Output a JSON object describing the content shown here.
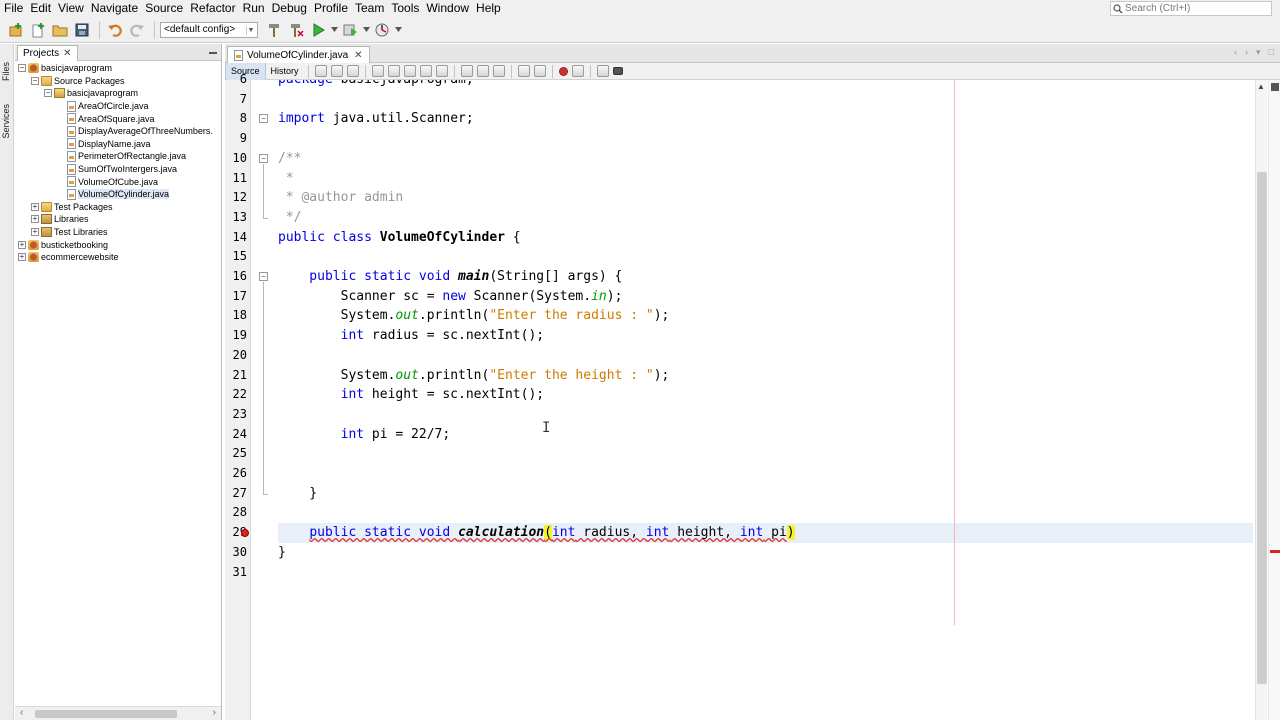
{
  "menu": [
    "File",
    "Edit",
    "View",
    "Navigate",
    "Source",
    "Refactor",
    "Run",
    "Debug",
    "Profile",
    "Team",
    "Tools",
    "Window",
    "Help"
  ],
  "search": {
    "placeholder": "Search (Ctrl+I)"
  },
  "toolbar": {
    "config": "<default config>"
  },
  "side_rail": [
    "Files",
    "Services"
  ],
  "projects_panel": {
    "tab_label": "Projects",
    "tree": [
      {
        "label": "basicjavaprogram",
        "type": "project",
        "depth": 0,
        "expanded": true
      },
      {
        "label": "Source Packages",
        "type": "folder",
        "depth": 1,
        "expanded": true
      },
      {
        "label": "basicjavaprogram",
        "type": "package",
        "depth": 2,
        "expanded": true
      },
      {
        "label": "AreaOfCircle.java",
        "type": "java",
        "depth": 3
      },
      {
        "label": "AreaOfSquare.java",
        "type": "java",
        "depth": 3
      },
      {
        "label": "DisplayAverageOfThreeNumbers.",
        "type": "java",
        "depth": 3
      },
      {
        "label": "DisplayName.java",
        "type": "java",
        "depth": 3
      },
      {
        "label": "PerimeterOfRectangle.java",
        "type": "java",
        "depth": 3
      },
      {
        "label": "SumOfTwoIntergers.java",
        "type": "java",
        "depth": 3
      },
      {
        "label": "VolumeOfCube.java",
        "type": "java",
        "depth": 3
      },
      {
        "label": "VolumeOfCylinder.java",
        "type": "java",
        "depth": 3,
        "selected": true
      },
      {
        "label": "Test Packages",
        "type": "folder",
        "depth": 1,
        "expanded": false
      },
      {
        "label": "Libraries",
        "type": "lib",
        "depth": 1,
        "expanded": false
      },
      {
        "label": "Test Libraries",
        "type": "lib",
        "depth": 1,
        "expanded": false
      },
      {
        "label": "busticketbooking",
        "type": "project",
        "depth": 0,
        "expanded": false
      },
      {
        "label": "ecommercewebsite",
        "type": "project",
        "depth": 0,
        "expanded": false
      }
    ]
  },
  "editor": {
    "file_tab": "VolumeOfCylinder.java",
    "modes": [
      "Source",
      "History"
    ],
    "active_mode": "Source",
    "line_numbers": [
      6,
      7,
      8,
      9,
      10,
      11,
      12,
      13,
      14,
      15,
      16,
      17,
      18,
      19,
      20,
      21,
      22,
      23,
      24,
      25,
      26,
      27,
      28,
      29,
      30,
      31
    ],
    "error_line": 29,
    "current_line": 29,
    "code": [
      [
        {
          "t": "package basicjavaprogram;",
          "c": "kw-partial"
        }
      ],
      [],
      [
        {
          "t": "import",
          "c": "kw"
        },
        {
          "t": " java.util.Scanner;",
          "c": ""
        }
      ],
      [],
      [
        {
          "t": "/**",
          "c": "cm"
        }
      ],
      [
        {
          "t": " *",
          "c": "cm"
        }
      ],
      [
        {
          "t": " * @author admin",
          "c": "cm"
        }
      ],
      [
        {
          "t": " */",
          "c": "cm"
        }
      ],
      [
        {
          "t": "public class ",
          "c": "kw"
        },
        {
          "t": "VolumeOfCylinder",
          "c": "cls"
        },
        {
          "t": " {",
          "c": ""
        }
      ],
      [],
      [
        {
          "t": "    public static void ",
          "c": "kw"
        },
        {
          "t": "main",
          "c": "fn-decl"
        },
        {
          "t": "(String[] args) {",
          "c": ""
        }
      ],
      [
        {
          "t": "        Scanner sc = ",
          "c": ""
        },
        {
          "t": "new",
          "c": "kw"
        },
        {
          "t": " Scanner(System.",
          "c": ""
        },
        {
          "t": "in",
          "c": "field"
        },
        {
          "t": ");",
          "c": ""
        }
      ],
      [
        {
          "t": "        System.",
          "c": ""
        },
        {
          "t": "out",
          "c": "field"
        },
        {
          "t": ".println(",
          "c": ""
        },
        {
          "t": "\"Enter the radius : \"",
          "c": "str"
        },
        {
          "t": ");",
          "c": ""
        }
      ],
      [
        {
          "t": "        int",
          "c": "kw"
        },
        {
          "t": " radius = sc.nextInt();",
          "c": ""
        }
      ],
      [],
      [
        {
          "t": "        System.",
          "c": ""
        },
        {
          "t": "out",
          "c": "field"
        },
        {
          "t": ".println(",
          "c": ""
        },
        {
          "t": "\"Enter the height : \"",
          "c": "str"
        },
        {
          "t": ");",
          "c": ""
        }
      ],
      [
        {
          "t": "        int",
          "c": "kw"
        },
        {
          "t": " height = sc.nextInt();",
          "c": ""
        }
      ],
      [],
      [
        {
          "t": "        int",
          "c": "kw"
        },
        {
          "t": " pi = 22/7;",
          "c": ""
        }
      ],
      [],
      [],
      [
        {
          "t": "    }",
          "c": ""
        }
      ],
      [],
      [
        {
          "t": "    ",
          "c": ""
        },
        {
          "t": "public static void ",
          "c": "kw err"
        },
        {
          "t": "calculation",
          "c": "fn-decl err"
        },
        {
          "t": "(",
          "c": "hl err"
        },
        {
          "t": "int",
          "c": "kw err"
        },
        {
          "t": " radius, ",
          "c": "err"
        },
        {
          "t": "int",
          "c": "kw err"
        },
        {
          "t": " height, ",
          "c": "err"
        },
        {
          "t": "int",
          "c": "kw err"
        },
        {
          "t": " pi",
          "c": "err"
        },
        {
          "t": ")",
          "c": "hl"
        }
      ],
      [
        {
          "t": "}",
          "c": ""
        }
      ],
      []
    ]
  },
  "colors": {
    "keyword": "#0000e6",
    "comment": "#969696",
    "string": "#ce7b00",
    "field": "#009900",
    "current_line": "#e9eff8",
    "bracket_match": "#f4f233",
    "error": "#dd2222"
  },
  "icons": [
    "new-project-icon",
    "new-file-icon",
    "open-project-icon",
    "save-all-icon",
    "undo-icon",
    "redo-icon",
    "build-icon",
    "clean-build-icon",
    "run-icon",
    "debug-icon",
    "profile-icon"
  ]
}
